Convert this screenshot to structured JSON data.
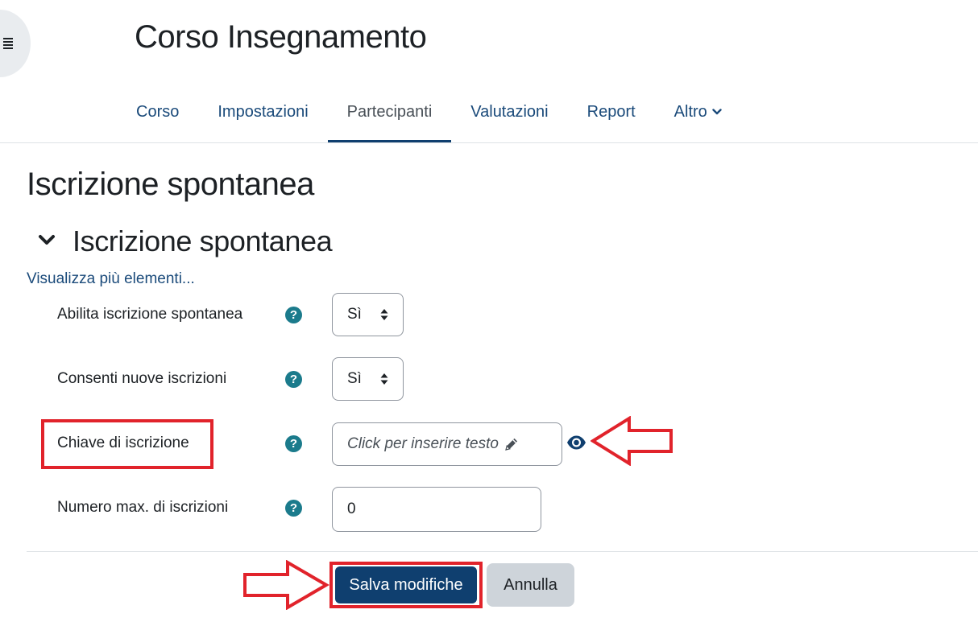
{
  "header": {
    "course_title": "Corso Insegnamento"
  },
  "tabs": [
    {
      "label": "Corso"
    },
    {
      "label": "Impostazioni"
    },
    {
      "label": "Partecipanti",
      "active": true
    },
    {
      "label": "Valutazioni"
    },
    {
      "label": "Report"
    },
    {
      "label": "Altro"
    }
  ],
  "main": {
    "page_heading": "Iscrizione spontanea",
    "section_title": "Iscrizione spontanea",
    "show_more": "Visualizza più elementi..."
  },
  "form": {
    "enable": {
      "label": "Abilita iscrizione spontanea",
      "value": "Sì"
    },
    "allow_new": {
      "label": "Consenti nuove iscrizioni",
      "value": "Sì"
    },
    "key": {
      "label": "Chiave di iscrizione",
      "placeholder": "Click per inserire testo"
    },
    "max": {
      "label": "Numero max. di iscrizioni",
      "value": "0"
    },
    "help_glyph": "?"
  },
  "actions": {
    "save_label": "Salva modifiche",
    "cancel_label": "Annulla"
  },
  "colors": {
    "primary": "#0f3f6f",
    "help_icon": "#1b7b8c",
    "annotation_red": "#e1232b"
  },
  "icons": [
    "hamburger-icon",
    "chevron-down-icon",
    "help-icon",
    "select-updown-icon",
    "pencil-icon",
    "eye-icon",
    "annotation-arrow"
  ]
}
